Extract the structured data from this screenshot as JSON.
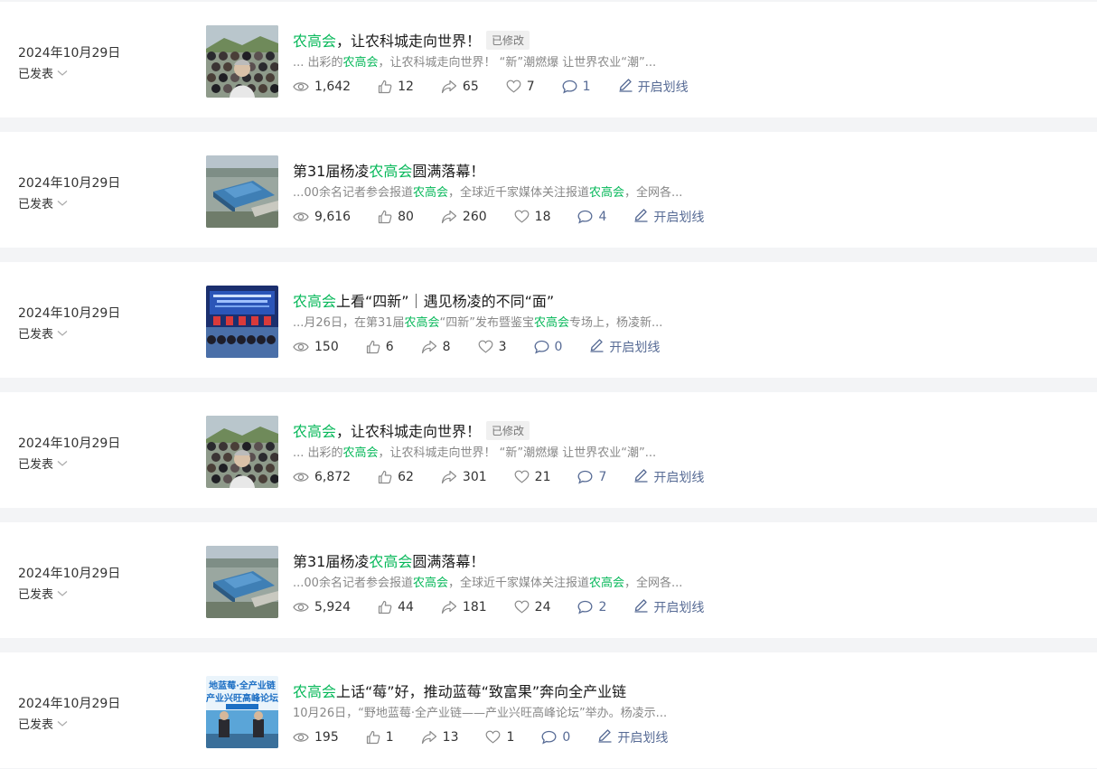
{
  "articles": [
    {
      "date": "2024年10月29日",
      "status": "已发表",
      "title_parts": [
        {
          "text": "农高会",
          "hl": true
        },
        {
          "text": "，让农科城走向世界！",
          "hl": false
        }
      ],
      "badge": "已修改",
      "snippet_parts": [
        {
          "text": "... 出彩的",
          "hl": false
        },
        {
          "text": "农高会",
          "hl": true
        },
        {
          "text": "，让农科城走向世界！ “新”潮燃爆 让世界农业“潮”...",
          "hl": false
        }
      ],
      "stats": {
        "views": "1,642",
        "likes": "12",
        "shares": "65",
        "favorites": "7",
        "comments": "1"
      },
      "annotate_label": "开启划线",
      "thumb": "crowd"
    },
    {
      "date": "2024年10月29日",
      "status": "已发表",
      "title_parts": [
        {
          "text": "第31届杨凌",
          "hl": false
        },
        {
          "text": "农高会",
          "hl": true
        },
        {
          "text": "圆满落幕！",
          "hl": false
        }
      ],
      "badge": "",
      "snippet_parts": [
        {
          "text": "...00余名记者参会报道",
          "hl": false
        },
        {
          "text": "农高会",
          "hl": true
        },
        {
          "text": "，全球近千家媒体关注报道",
          "hl": false
        },
        {
          "text": "农高会",
          "hl": true
        },
        {
          "text": "，全网各...",
          "hl": false
        }
      ],
      "stats": {
        "views": "9,616",
        "likes": "80",
        "shares": "260",
        "favorites": "18",
        "comments": "4"
      },
      "annotate_label": "开启划线",
      "thumb": "aerial"
    },
    {
      "date": "2024年10月29日",
      "status": "已发表",
      "title_parts": [
        {
          "text": "农高会",
          "hl": true
        },
        {
          "text": "上看“四新”｜遇见杨凌的不同“面”",
          "hl": false
        }
      ],
      "badge": "",
      "snippet_parts": [
        {
          "text": "...月26日，在第31届",
          "hl": false
        },
        {
          "text": "农高会",
          "hl": true
        },
        {
          "text": "“四新”发布暨鉴宝",
          "hl": false
        },
        {
          "text": "农高会",
          "hl": true
        },
        {
          "text": "专场上，杨凌新...",
          "hl": false
        }
      ],
      "stats": {
        "views": "150",
        "likes": "6",
        "shares": "8",
        "favorites": "3",
        "comments": "0"
      },
      "annotate_label": "开启划线",
      "thumb": "stage"
    },
    {
      "date": "2024年10月29日",
      "status": "已发表",
      "title_parts": [
        {
          "text": "农高会",
          "hl": true
        },
        {
          "text": "，让农科城走向世界！",
          "hl": false
        }
      ],
      "badge": "已修改",
      "snippet_parts": [
        {
          "text": "... 出彩的",
          "hl": false
        },
        {
          "text": "农高会",
          "hl": true
        },
        {
          "text": "，让农科城走向世界！ “新”潮燃爆 让世界农业“潮”...",
          "hl": false
        }
      ],
      "stats": {
        "views": "6,872",
        "likes": "62",
        "shares": "301",
        "favorites": "21",
        "comments": "7"
      },
      "annotate_label": "开启划线",
      "thumb": "crowd"
    },
    {
      "date": "2024年10月29日",
      "status": "已发表",
      "title_parts": [
        {
          "text": "第31届杨凌",
          "hl": false
        },
        {
          "text": "农高会",
          "hl": true
        },
        {
          "text": "圆满落幕！",
          "hl": false
        }
      ],
      "badge": "",
      "snippet_parts": [
        {
          "text": "...00余名记者参会报道",
          "hl": false
        },
        {
          "text": "农高会",
          "hl": true
        },
        {
          "text": "，全球近千家媒体关注报道",
          "hl": false
        },
        {
          "text": "农高会",
          "hl": true
        },
        {
          "text": "，全网各...",
          "hl": false
        }
      ],
      "stats": {
        "views": "5,924",
        "likes": "44",
        "shares": "181",
        "favorites": "24",
        "comments": "2"
      },
      "annotate_label": "开启划线",
      "thumb": "aerial"
    },
    {
      "date": "2024年10月29日",
      "status": "已发表",
      "title_parts": [
        {
          "text": "农高会",
          "hl": true
        },
        {
          "text": "上话“莓”好，推动蓝莓“致富果”奔向全产业链",
          "hl": false
        }
      ],
      "badge": "",
      "snippet_parts": [
        {
          "text": "10月26日，“野地蓝莓·全产业链——产业兴旺高峰论坛”举办。杨凌示...",
          "hl": false
        }
      ],
      "stats": {
        "views": "195",
        "likes": "1",
        "shares": "13",
        "favorites": "1",
        "comments": "0"
      },
      "annotate_label": "开启划线",
      "thumb": "forum",
      "thumb_text": [
        "地蓝莓·全产业链",
        "产业兴旺高峰论坛"
      ]
    }
  ],
  "colors": {
    "highlight": "#07b85a",
    "link": "#576b95",
    "background": "#f3f4f6"
  }
}
